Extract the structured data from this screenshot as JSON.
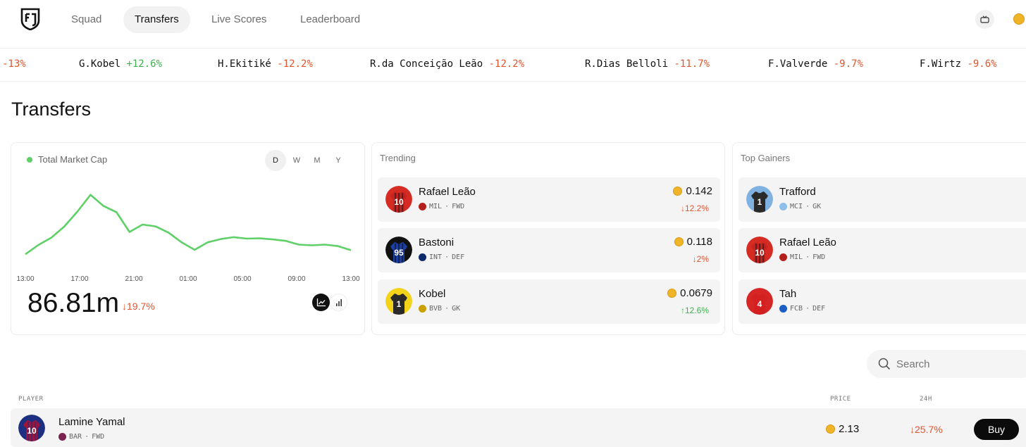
{
  "nav": {
    "tabs": [
      {
        "label": "Squad",
        "active": false
      },
      {
        "label": "Transfers",
        "active": true
      },
      {
        "label": "Live Scores",
        "active": false
      },
      {
        "label": "Leaderboard",
        "active": false
      }
    ],
    "right_icon": "tv-icon",
    "coin_icon": "coin-icon"
  },
  "ticker": [
    {
      "name": "",
      "change": "-13%",
      "dir": "neg"
    },
    {
      "name": "G.Kobel",
      "change": "+12.6%",
      "dir": "pos"
    },
    {
      "name": "H.Ekitiké",
      "change": "-12.2%",
      "dir": "neg"
    },
    {
      "name": "R.da Conceição Leão",
      "change": "-12.2%",
      "dir": "neg"
    },
    {
      "name": "R.Dias Belloli",
      "change": "-11.7%",
      "dir": "neg"
    },
    {
      "name": "F.Valverde",
      "change": "-9.7%",
      "dir": "neg"
    },
    {
      "name": "F.Wirtz",
      "change": "-9.6%",
      "dir": "neg"
    }
  ],
  "page_title": "Transfers",
  "market_cap": {
    "label": "Total Market Cap",
    "periods": [
      "D",
      "W",
      "M",
      "Y"
    ],
    "active_period": "D",
    "value": "86.81m",
    "change": "↓19.7%",
    "line_color": "#5fd068",
    "view_icons": [
      "line-chart-icon",
      "bar-chart-icon"
    ]
  },
  "chart_data": {
    "type": "line",
    "title": "Total Market Cap",
    "x_ticks": [
      "13:00",
      "17:00",
      "21:00",
      "01:00",
      "05:00",
      "09:00",
      "13:00"
    ],
    "values": [
      91.0,
      93.5,
      95.5,
      98.5,
      102.5,
      107.0,
      104.0,
      102.3,
      97.0,
      99.0,
      98.5,
      96.8,
      94.2,
      92.2,
      94.2,
      95.1,
      95.6,
      95.2,
      95.3,
      95.0,
      94.6,
      93.6,
      93.4,
      93.6,
      93.2,
      92.1
    ],
    "ylim": [
      88,
      110
    ],
    "grid": false,
    "series": [
      {
        "values": [
          91.0,
          93.5,
          95.5,
          98.5,
          102.5,
          107.0,
          104.0,
          102.3,
          97.0,
          99.0,
          98.5,
          96.8,
          94.2,
          92.2,
          94.2,
          95.1,
          95.6,
          95.2,
          95.3,
          95.0,
          94.6,
          93.6,
          93.4,
          93.6,
          93.2,
          92.1
        ]
      }
    ]
  },
  "trending": {
    "title": "Trending",
    "items": [
      {
        "name": "Rafael Leão",
        "club": "MIL",
        "pos": "FWD",
        "price": "0.142",
        "change": "↓12.2%",
        "dir": "neg",
        "kit": [
          "#c8231e",
          "#1a1a1a"
        ],
        "number": "10",
        "club_color": "#b3211d",
        "ring": "#d62b22"
      },
      {
        "name": "Bastoni",
        "club": "INT",
        "pos": "DEF",
        "price": "0.118",
        "change": "↓2%",
        "dir": "neg",
        "kit": [
          "#1a3fa8",
          "#111111"
        ],
        "number": "95",
        "club_color": "#0c2a6b",
        "ring": "#111111"
      },
      {
        "name": "Kobel",
        "club": "BVB",
        "pos": "GK",
        "price": "0.0679",
        "change": "↑12.6%",
        "dir": "pos",
        "kit": [
          "#2a2a2a",
          "#2a2a2a"
        ],
        "number": "1",
        "club_color": "#c9a000",
        "ring": "#f3d21a"
      }
    ]
  },
  "top_gainers": {
    "title": "Top Gainers",
    "items": [
      {
        "name": "Trafford",
        "club": "MCI",
        "pos": "GK",
        "kit": [
          "#2a2a2a",
          "#2a2a2a"
        ],
        "number": "1",
        "club_color": "#8fbfe8",
        "ring": "#7fb2e0"
      },
      {
        "name": "Rafael Leão",
        "club": "MIL",
        "pos": "FWD",
        "kit": [
          "#c8231e",
          "#1a1a1a"
        ],
        "number": "10",
        "club_color": "#b3211d",
        "ring": "#d62b22"
      },
      {
        "name": "Tah",
        "club": "FCB",
        "pos": "DEF",
        "kit": [
          "#d32020",
          "#d32020"
        ],
        "number": "4",
        "club_color": "#1b5dc5",
        "ring": "#d52525"
      }
    ]
  },
  "search": {
    "placeholder": "Search"
  },
  "table": {
    "headers": {
      "player": "PLAYER",
      "price": "PRICE",
      "change": "24H"
    },
    "rows": [
      {
        "name": "Lamine Yamal",
        "club": "BAR",
        "pos": "FWD",
        "price": "2.13",
        "change": "↓25.7%",
        "buy": "Buy",
        "kit": [
          "#a1143a",
          "#1c2f80"
        ],
        "number": "10",
        "club_color": "#7a2350",
        "ring": "#1c2f80"
      }
    ]
  },
  "colors": {
    "negative": "#e2552e",
    "positive": "#3fb24e",
    "accent": "#0b0b0b"
  }
}
